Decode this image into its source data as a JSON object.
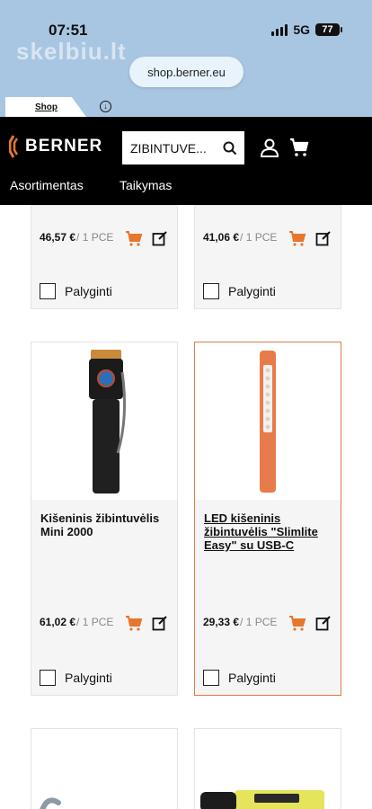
{
  "status": {
    "time": "07:51",
    "network": "5G",
    "battery": "77"
  },
  "browser": {
    "watermark": "skelbiu.lt",
    "url": "shop.berner.eu",
    "tab_label": "Shop"
  },
  "header": {
    "brand": "BERNER",
    "search_value": "ZIBINTUVE...",
    "nav": [
      "Asortimentas",
      "Taikymas"
    ]
  },
  "colors": {
    "accent": "#e07a4a",
    "cart": "#e8762d",
    "header_bg": "#000000"
  },
  "compare_label": "Palyginti",
  "products": [
    {
      "title": "",
      "price": "46,57 €",
      "unit": "/ 1 PCE"
    },
    {
      "title": "",
      "price": "41,06 €",
      "unit": "/ 1 PCE"
    },
    {
      "title": "Kišeninis žibintuvėlis Mini 2000",
      "price": "61,02 €",
      "unit": "/ 1 PCE"
    },
    {
      "title": "LED kišeninis žibintuvėlis \"Slimlite Easy\" su USB-C",
      "price": "29,33 €",
      "unit": "/ 1 PCE"
    }
  ]
}
